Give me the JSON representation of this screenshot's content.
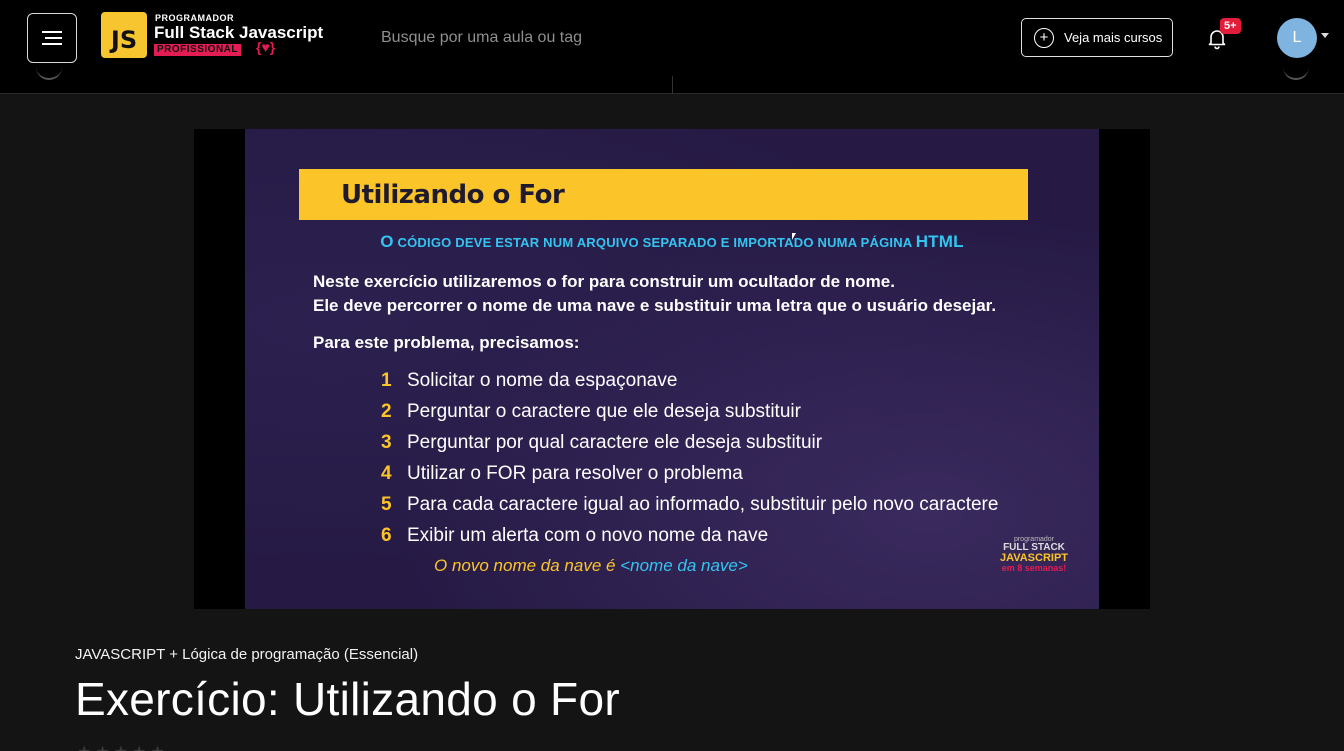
{
  "header": {
    "menu_icon": "hamburger-icon",
    "logo": {
      "badge": "JS",
      "top": "PROGRAMADOR",
      "main": "Full Stack Javascript",
      "tag": "PROFISSIONAL",
      "brace": "{♥}"
    },
    "search": {
      "placeholder": "Busque por uma aula ou tag",
      "value": ""
    },
    "courses_button": {
      "label": "Veja mais cursos",
      "icon": "plus-circle-icon"
    },
    "notifications": {
      "icon": "bell-icon",
      "badge": "5+"
    },
    "user": {
      "avatar_letter": "L"
    }
  },
  "video": {
    "slide": {
      "title": "Utilizando o For",
      "subtitle_prefix": "O",
      "subtitle_body": "CÓDIGO DEVE ESTAR NUM ARQUIVO SEPARADO E IMPORTADO NUMA PÁGINA",
      "subtitle_suffix": "HTML",
      "para1": "Neste exercício utilizaremos o for para construir um ocultador de nome.",
      "para2": "Ele deve percorrer o nome de uma nave e substituir uma letra que o usuário desejar.",
      "para3": "Para este problema, precisamos:",
      "steps": [
        {
          "num": "1",
          "text": "Solicitar o nome da espaçonave"
        },
        {
          "num": "2",
          "text": "Perguntar o caractere que ele deseja substituir"
        },
        {
          "num": "3",
          "text": "Perguntar por qual caractere ele deseja substituir"
        },
        {
          "num": "4",
          "text": "Utilizar o FOR para resolver o problema"
        },
        {
          "num": "5",
          "text": "Para cada caractere igual ao informado, substituir pelo novo caractere"
        },
        {
          "num": "6",
          "text": "Exibir um alerta com o novo nome da nave"
        }
      ],
      "footer_a": "O novo nome da nave é",
      "footer_b": "<nome da nave>",
      "watermark": {
        "line1": "programador",
        "line2": "FULL STACK",
        "line3": "JAVASCRIPT",
        "line4": "em 8 semanas!"
      }
    }
  },
  "lesson": {
    "course": "JAVASCRIPT + Lógica de programação (Essencial)",
    "title": "Exercício: Utilizando o For"
  },
  "colors": {
    "accent_yellow": "#fbc52a",
    "accent_cyan": "#33c4f0",
    "brand_pink": "#e41c54",
    "slide_bg": "#261a45",
    "page_bg": "#141414"
  }
}
